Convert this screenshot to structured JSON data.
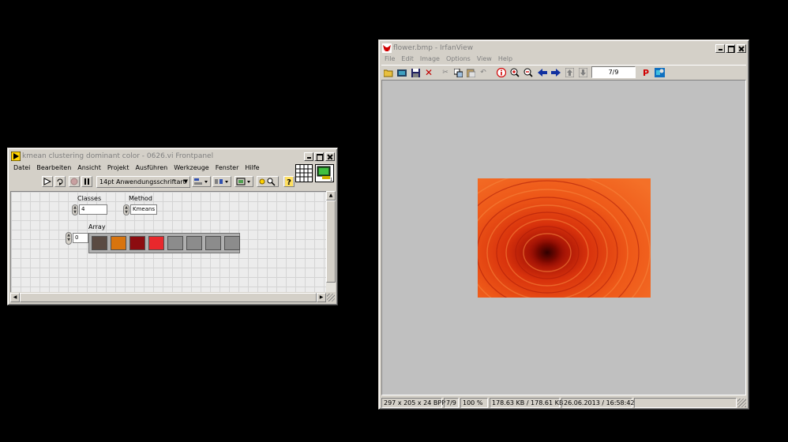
{
  "labview": {
    "title": "kmean clustering dominant color - 0626.vi Frontpanel",
    "menu": [
      "Datei",
      "Bearbeiten",
      "Ansicht",
      "Projekt",
      "Ausführen",
      "Werkzeuge",
      "Fenster",
      "Hilfe"
    ],
    "font_selector": "14pt Anwendungsschriftart",
    "classes_label": "Classes",
    "classes_value": "4",
    "method_label": "Method",
    "method_value": "Kmeans",
    "array_label": "Array",
    "array_index": "0",
    "array_colors": [
      "#5a4a42",
      "#d8740e",
      "#8c0c10",
      "#e8282c",
      "#8c8c8c",
      "#8c8c8c",
      "#8c8c8c",
      "#8c8c8c"
    ]
  },
  "irfan": {
    "title": "flower.bmp - IrfanView",
    "menu": [
      "File",
      "Edit",
      "Image",
      "Options",
      "View",
      "Help"
    ],
    "page_counter": "7/9",
    "status": {
      "dimensions": "297 x 205 x 24 BPP",
      "index": "7/9",
      "zoom": "100 %",
      "size": "178.63 KB / 178.61 KB",
      "datetime": "26.06.2013 / 16:58:42"
    }
  }
}
